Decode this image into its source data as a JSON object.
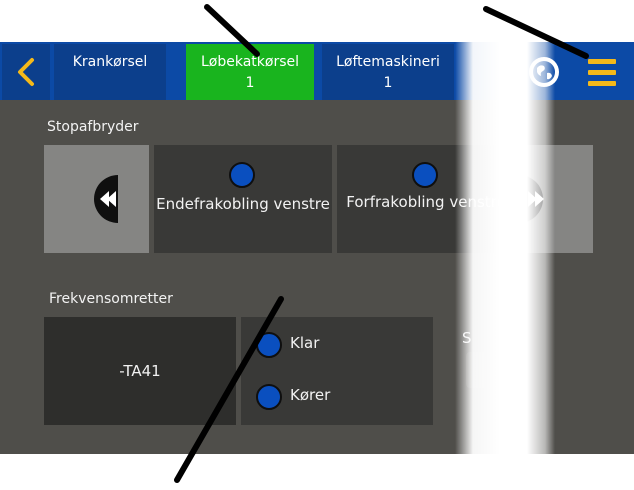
{
  "tabs": [
    {
      "label": "Krankørsel",
      "count": ""
    },
    {
      "label": "Løbekatkørsel",
      "count": "1"
    },
    {
      "label": "Løftemaskineri",
      "count": "1"
    }
  ],
  "sections": {
    "stop_switch": {
      "title": "Stopafbryder",
      "items": [
        {
          "label": "Endefrakobling venstre"
        },
        {
          "label": "Forfrakobling venstre"
        }
      ]
    },
    "frequency_converter": {
      "title": "Frekvensomretter",
      "device": "-TA41",
      "statuses": [
        {
          "label": "Klar"
        },
        {
          "label": "Kører"
        }
      ],
      "partial_label": "S"
    }
  },
  "colors": {
    "header_blue": "#0c4aa6",
    "active_tab_green": "#19b41e",
    "menu_yellow": "#f4b91a",
    "led_blue": "#0a4fbf",
    "panel_bg": "#4f4e4a"
  }
}
